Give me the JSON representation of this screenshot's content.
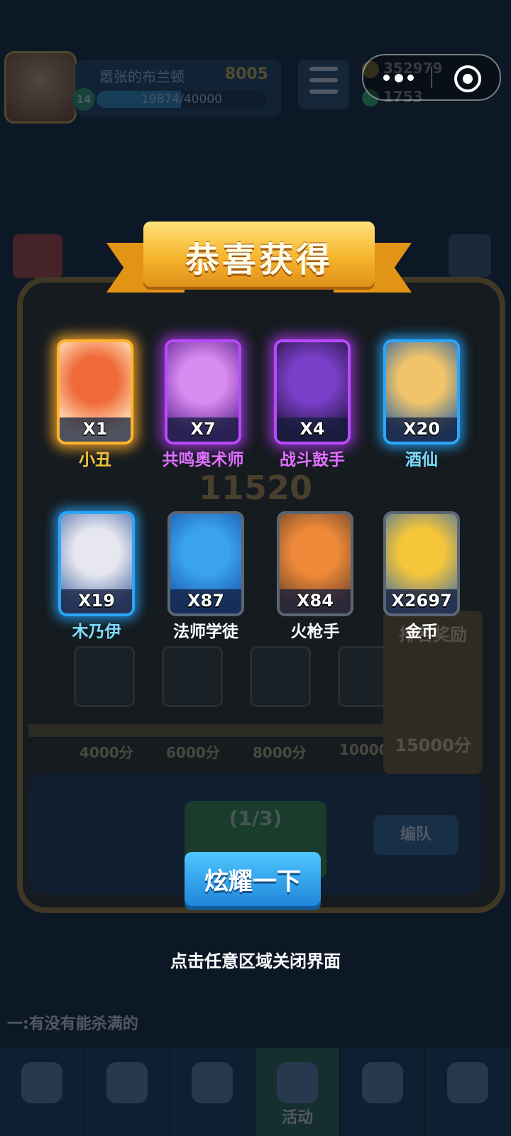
{
  "background": {
    "player_name": "嚣张的布兰顿",
    "trophies": "8005",
    "xp_text": "19874/40000",
    "xp_fraction": 0.4969,
    "level": "14",
    "coins": "352979",
    "gems": "1753",
    "big_score": "11520",
    "milestones": [
      "4000分",
      "6000分",
      "8000分",
      "10000"
    ],
    "reward_qty": "X1",
    "final_reward_title": "排名奖励",
    "final_reward_score": "15000分",
    "start_label": "(1/3)",
    "team_label": "编队",
    "chat_text": "一:有没有能杀满的",
    "nav_active_label": "活动"
  },
  "modal": {
    "title": "恭喜获得",
    "rewards": [
      {
        "name": "小丑",
        "qty": "X1",
        "rarity": "legendary",
        "name_color": "#f7c53a",
        "art_colors": [
          "#f06a3a",
          "#fff1c8"
        ]
      },
      {
        "name": "共鸣奥术师",
        "qty": "X7",
        "rarity": "epic",
        "name_color": "#e070ff",
        "art_colors": [
          "#d88bf0",
          "#6a2a9a"
        ]
      },
      {
        "name": "战斗鼓手",
        "qty": "X4",
        "rarity": "epic",
        "name_color": "#e070ff",
        "art_colors": [
          "#7a3fc8",
          "#2b1848"
        ]
      },
      {
        "name": "酒仙",
        "qty": "X20",
        "rarity": "rare",
        "name_color": "#7fdcff",
        "art_colors": [
          "#f2c46a",
          "#3a6a9a"
        ]
      },
      {
        "name": "木乃伊",
        "qty": "X19",
        "rarity": "rare",
        "name_color": "#7fdcff",
        "art_colors": [
          "#e7e7ef",
          "#5a7ab0"
        ]
      },
      {
        "name": "法师学徒",
        "qty": "X87",
        "rarity": "common",
        "name_color": "#ffffff",
        "art_colors": [
          "#3aa3f0",
          "#1c5fb0"
        ]
      },
      {
        "name": "火枪手",
        "qty": "X84",
        "rarity": "common",
        "name_color": "#ffffff",
        "art_colors": [
          "#f08a3a",
          "#7a4a2a"
        ]
      },
      {
        "name": "金币",
        "qty": "X2697",
        "rarity": "common",
        "name_color": "#ffffff",
        "art_colors": [
          "#f6c63a",
          "#5a7a95"
        ]
      }
    ],
    "show_button": "炫耀一下",
    "close_hint": "点击任意区域关闭界面"
  },
  "icons": {
    "capsule_menu": "more-dots-icon",
    "capsule_close": "target-circle-icon"
  }
}
